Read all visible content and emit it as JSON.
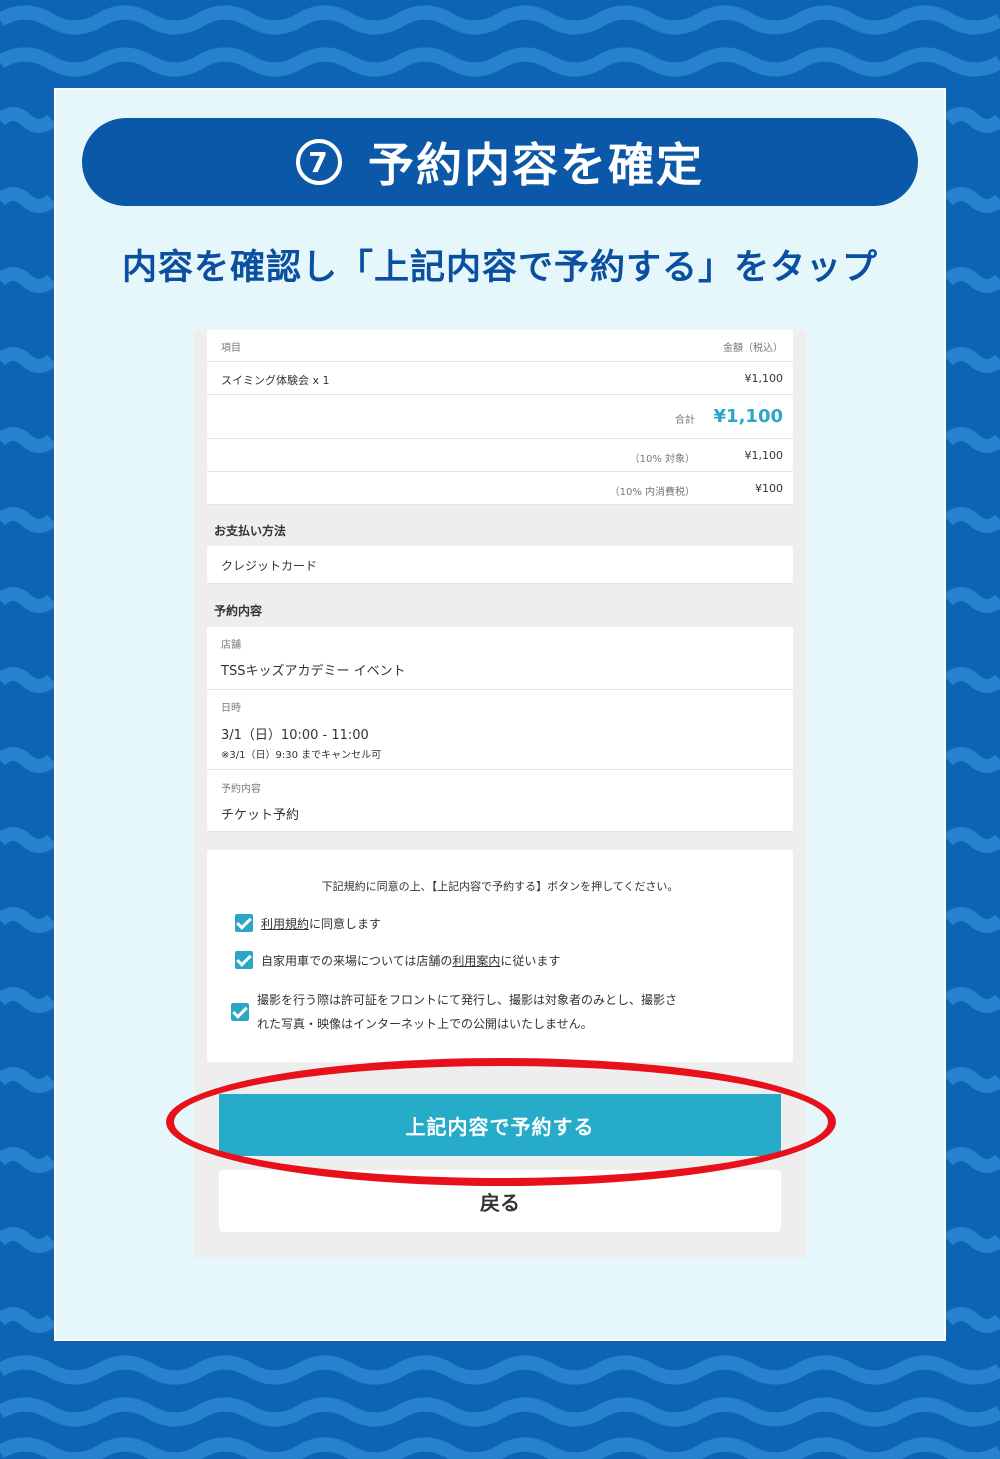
{
  "colors": {
    "background": "#0d64b4",
    "banner": "#0b57a8",
    "accent": "#26abc9",
    "highlight_ring": "#e8101a"
  },
  "banner": {
    "step_number": "7",
    "title": "予約内容を確定"
  },
  "instruction": "内容を確認し「上記内容で予約する」をタップ",
  "summary": {
    "header_item": "項目",
    "header_amount": "金額（税込）",
    "line_item": "スイミング体験会 x 1",
    "line_price": "¥1,100",
    "total_label": "合計",
    "total_value": "¥1,100",
    "tax_target_label": "（10% 対象）",
    "tax_target_value": "¥1,100",
    "tax_label": "（10% 内消費税）",
    "tax_value": "¥100"
  },
  "payment": {
    "section_title": "お支払い方法",
    "method": "クレジットカード"
  },
  "reservation": {
    "section_title": "予約内容",
    "store_label": "店舗",
    "store_value": "TSSキッズアカデミー イベント",
    "datetime_label": "日時",
    "datetime_value": "3/1（日）10:00 - 11:00",
    "cancel_note": "※3/1（日）9:30 までキャンセル可",
    "content_label": "予約内容",
    "content_value": "チケット予約"
  },
  "agreement": {
    "intro": "下記規約に同意の上、【上記内容で予約する】ボタンを押してください。",
    "check1_link": "利用規約",
    "check1_rest": "に同意します",
    "check2_pre": "自家用車での来場については店舗の",
    "check2_link": "利用案内",
    "check2_post": "に従います",
    "check3_line1": "撮影を行う際は許可証をフロントにて発行し、撮影は対象者のみとし、撮影さ",
    "check3_line2": "れた写真・映像はインターネット上での公開はいたしません。"
  },
  "buttons": {
    "confirm": "上記内容で予約する",
    "back": "戻る"
  }
}
